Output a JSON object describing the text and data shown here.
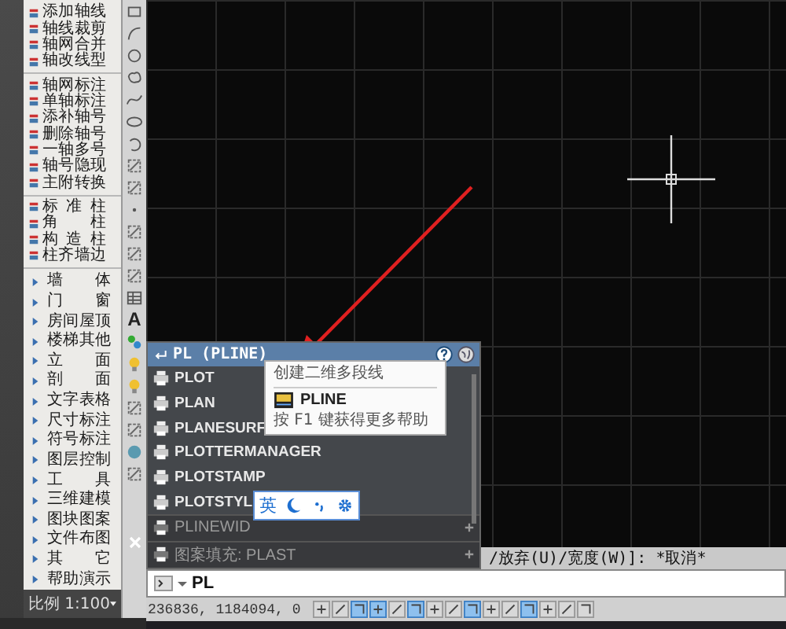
{
  "side_menu": {
    "groups": [
      {
        "items": [
          {
            "label": "添加轴线",
            "kind": "command"
          },
          {
            "label": "轴线裁剪",
            "kind": "command"
          },
          {
            "label": "轴网合并",
            "kind": "command"
          },
          {
            "label": "轴改线型",
            "kind": "command"
          }
        ]
      },
      {
        "items": [
          {
            "label": "轴网标注",
            "kind": "command"
          },
          {
            "label": "单轴标注",
            "kind": "command"
          },
          {
            "label": "添补轴号",
            "kind": "command"
          },
          {
            "label": "删除轴号",
            "kind": "command"
          },
          {
            "label": "一轴多号",
            "kind": "command"
          },
          {
            "label": "轴号隐现",
            "kind": "command"
          },
          {
            "label": "主附转换",
            "kind": "command"
          }
        ]
      },
      {
        "items": [
          {
            "label": "标 准 柱",
            "kind": "command"
          },
          {
            "label": "角 柱",
            "kind": "command"
          },
          {
            "label": "构 造 柱",
            "kind": "command"
          },
          {
            "label": "柱齐墙边",
            "kind": "command"
          }
        ]
      },
      {
        "items": [
          {
            "label": "墙 体",
            "kind": "submenu"
          },
          {
            "label": "门 窗",
            "kind": "submenu"
          },
          {
            "label": "房间屋顶",
            "kind": "submenu"
          },
          {
            "label": "楼梯其他",
            "kind": "submenu"
          },
          {
            "label": "立 面",
            "kind": "submenu"
          },
          {
            "label": "剖 面",
            "kind": "submenu"
          },
          {
            "label": "文字表格",
            "kind": "submenu"
          },
          {
            "label": "尺寸标注",
            "kind": "submenu"
          },
          {
            "label": "符号标注",
            "kind": "submenu"
          },
          {
            "label": "图层控制",
            "kind": "submenu"
          },
          {
            "label": "工 具",
            "kind": "submenu"
          },
          {
            "label": "三维建模",
            "kind": "submenu"
          },
          {
            "label": "图块图案",
            "kind": "submenu"
          },
          {
            "label": "文件布图",
            "kind": "submenu"
          },
          {
            "label": "其 它",
            "kind": "submenu"
          },
          {
            "label": "帮助演示",
            "kind": "submenu"
          }
        ]
      }
    ]
  },
  "toolbar": {
    "text_tool": "A"
  },
  "autocomplete": {
    "header": "PL (PLINE)",
    "items": [
      {
        "label": "PLOT",
        "disabled": false
      },
      {
        "label": "PLAN",
        "disabled": false
      },
      {
        "label": "PLANESURF",
        "disabled": false
      },
      {
        "label": "PLOTTERMANAGER",
        "disabled": false
      },
      {
        "label": "PLOTSTAMP",
        "disabled": false
      },
      {
        "label": "PLOTSTYL",
        "disabled": false
      },
      {
        "label": "PLINEWID",
        "disabled": true
      },
      {
        "label": "图案填充: PLAST",
        "disabled": true
      }
    ]
  },
  "tooltip": {
    "description": "创建二维多段线",
    "command": "PLINE",
    "help": "按 F1 键获得更多帮助"
  },
  "ime_bar": {
    "mode": "英"
  },
  "command_line": {
    "history": "/放弃(U)/宽度(W)]: *取消*",
    "input": "PL"
  },
  "status_bar": {
    "scale": "比例 1:100",
    "coordinates": "236836, 1184094, 0",
    "toggles": [
      {
        "on": false
      },
      {
        "on": false
      },
      {
        "on": true
      },
      {
        "on": true
      },
      {
        "on": false
      },
      {
        "on": true
      },
      {
        "on": false
      },
      {
        "on": false
      },
      {
        "on": true
      },
      {
        "on": false
      },
      {
        "on": false
      },
      {
        "on": true
      },
      {
        "on": false
      },
      {
        "on": false
      },
      {
        "on": false
      }
    ]
  }
}
